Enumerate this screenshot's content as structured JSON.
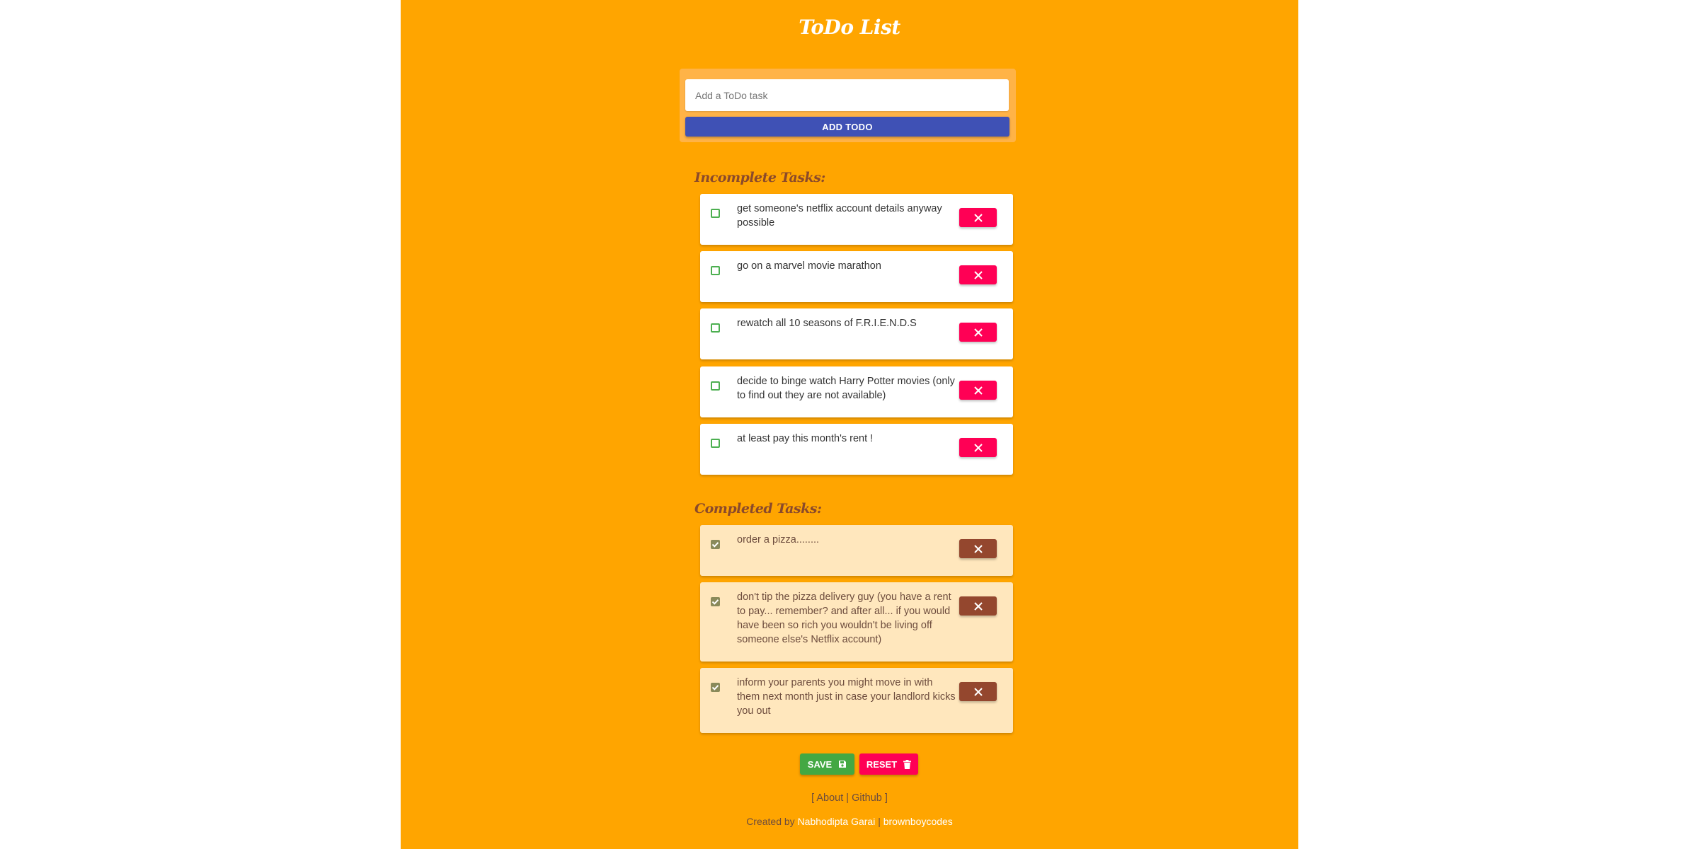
{
  "app": {
    "title": "ToDo List"
  },
  "form": {
    "placeholder": "Add a ToDo task",
    "add_label": "ADD TODO"
  },
  "incomplete": {
    "heading": "Incomplete Tasks:",
    "tasks": [
      "get someone's netflix account details anyway possible",
      "go on a marvel movie marathon",
      "rewatch all 10 seasons of F.R.I.E.N.D.S",
      "decide to binge watch Harry Potter movies (only to find out they are not available)",
      "at least pay this month's rent !"
    ]
  },
  "completed": {
    "heading": "Completed Tasks:",
    "tasks": [
      "order a pizza........",
      "don't tip the pizza delivery guy (you have a rent to pay... remember? and after all... if you would have been so rich you wouldn't be living off someone else's Netflix account)",
      "inform your parents you might move in with them next month just in case your landlord kicks you out"
    ]
  },
  "actions": {
    "save_label": "SAVE",
    "reset_label": "RESET"
  },
  "footer": {
    "open_bracket": "[",
    "about": "About",
    "separator": "|",
    "github": "Github",
    "close_bracket": "]",
    "created_by": "Created by",
    "author": "Nabhodipta Garai",
    "handle": "brownboycodes"
  },
  "colors": {
    "background": "#ffa500",
    "primary_button": "#3f51b5",
    "delete_button": "#ff0055",
    "completed_delete_button": "#94472e",
    "save_button": "#43a843",
    "checkbox": "#4caf50"
  }
}
